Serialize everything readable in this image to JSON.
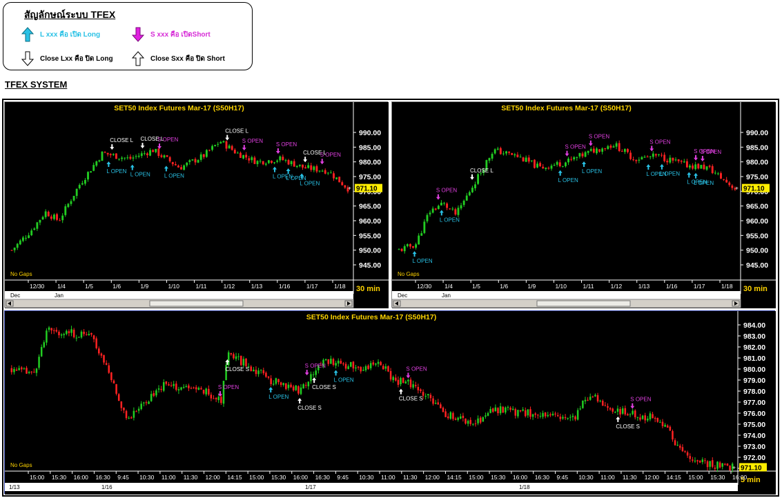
{
  "legend": {
    "title": "สัญลักษณ์ระบบ TFEX",
    "items": [
      {
        "text": "L xxx คือ เปิด Long",
        "icon": "arrow-up-cyan-icon",
        "color": "#29c1e5"
      },
      {
        "text": "S xxx คือ เปิดShort",
        "icon": "arrow-down-magenta-icon",
        "color": "#d62bd6"
      },
      {
        "text": "Close Lxx คือ ปิด Long",
        "icon": "arrow-down-outline-icon",
        "color": "#000000"
      },
      {
        "text": "Close Sxx คือ ปิด Short",
        "icon": "arrow-up-outline-icon",
        "color": "#000000"
      }
    ]
  },
  "section_title": "TFEX SYSTEM",
  "colors": {
    "up": "#22cc22",
    "down": "#ff2222",
    "long": "#29c1e5",
    "short": "#e040e0",
    "close": "#ffffff",
    "last_bg": "#ffee00"
  },
  "charts": [
    {
      "title": "SET50  Index  Futures  Mar-17  (S50H17)",
      "timeframe": "30  min",
      "no_gaps": "No  Gaps",
      "last_price": "971.10",
      "y_ticks": [
        "990.00",
        "985.00",
        "980.00",
        "975.00",
        "970.00",
        "965.00",
        "960.00",
        "955.00",
        "950.00",
        "945.00"
      ],
      "y_min": 945,
      "y_max": 990,
      "x_ticks": [
        "12/30",
        "1/4",
        "1/5",
        "1/6",
        "1/9",
        "1/10",
        "1/11",
        "1/12",
        "1/13",
        "1/16",
        "1/17",
        "1/18"
      ],
      "x_months": [
        "Dec",
        "Jan"
      ],
      "signals": [
        {
          "label": "CLOSE  L"
        },
        {
          "label": "CLOSE  L"
        },
        {
          "label": "S  OPEN"
        },
        {
          "label": "L  OPEN"
        },
        {
          "label": "L  OPEN"
        },
        {
          "label": "L  OPEN"
        },
        {
          "label": "CLOSE  L"
        },
        {
          "label": "S  OPEN"
        },
        {
          "label": "S  OPEN"
        },
        {
          "label": "L  OPEN"
        },
        {
          "label": "CLOSE  L"
        },
        {
          "label": "S  OPEN"
        },
        {
          "label": "L  OPEN"
        },
        {
          "label": "L  OPEN"
        }
      ]
    },
    {
      "title": "SET50  Index  Futures  Mar-17  (S50H17)",
      "timeframe": "30  min",
      "no_gaps": "No  Gaps",
      "last_price": "971.10",
      "y_ticks": [
        "990.00",
        "985.00",
        "980.00",
        "975.00",
        "970.00",
        "965.00",
        "960.00",
        "955.00",
        "950.00",
        "945.00"
      ],
      "y_min": 945,
      "y_max": 990,
      "x_ticks": [
        "12/30",
        "1/4",
        "1/5",
        "1/6",
        "1/9",
        "1/10",
        "1/11",
        "1/12",
        "1/13",
        "1/16",
        "1/17",
        "1/18"
      ],
      "x_months": [
        "Dec",
        "Jan"
      ],
      "signals": [
        {
          "label": "L  OPEN"
        },
        {
          "label": "S  OPEN"
        },
        {
          "label": "L  OPEN"
        },
        {
          "label": "CLOSE  L"
        },
        {
          "label": "S  OPEN"
        },
        {
          "label": "S  OPEN"
        },
        {
          "label": "L  OPEN"
        },
        {
          "label": "L  OPEN"
        },
        {
          "label": "S  OPEN"
        },
        {
          "label": "L  OPEN"
        },
        {
          "label": "L  OPEN"
        },
        {
          "label": "S  OPEN"
        },
        {
          "label": "S  OPEN"
        },
        {
          "label": "L  OPEN"
        },
        {
          "label": "L  OPEN"
        }
      ]
    },
    {
      "title": "SET50  Index  Futures  Mar-17  (S50H17)",
      "timeframe": "5  min",
      "no_gaps": "No  Gaps",
      "last_price": "971.10",
      "y_ticks": [
        "984.00",
        "983.00",
        "982.00",
        "981.00",
        "980.00",
        "979.00",
        "978.00",
        "977.00",
        "976.00",
        "975.00",
        "974.00",
        "973.00",
        "972.00",
        "971.00"
      ],
      "y_min": 971,
      "y_max": 984,
      "x_ticks": [
        "15:00",
        "15:30",
        "16:00",
        "16:30",
        "9:45",
        "10:30",
        "11:00",
        "11:30",
        "12:00",
        "14:15",
        "15:00",
        "15:30",
        "16:00",
        "16:30",
        "9:45",
        "10:30",
        "11:00",
        "11:30",
        "12:00",
        "14:15",
        "15:00",
        "15:30",
        "16:00",
        "16:30",
        "9:45",
        "10:30",
        "11:00",
        "11:30",
        "12:00",
        "14:15",
        "15:00",
        "15:30",
        "16:00"
      ],
      "x_dates": [
        "1/13",
        "1/16",
        "1/17",
        "1/18"
      ],
      "signals": [
        {
          "label": "CLOSE  S"
        },
        {
          "label": "S  OPEN"
        },
        {
          "label": "L  OPEN"
        },
        {
          "label": "S  OPEN"
        },
        {
          "label": "CLOSE  S"
        },
        {
          "label": "CLOSE  S"
        },
        {
          "label": "L  OPEN"
        },
        {
          "label": "CLOSE  S"
        },
        {
          "label": "S  OPEN"
        },
        {
          "label": "S  OPEN"
        },
        {
          "label": "CLOSE  S"
        }
      ]
    }
  ]
}
